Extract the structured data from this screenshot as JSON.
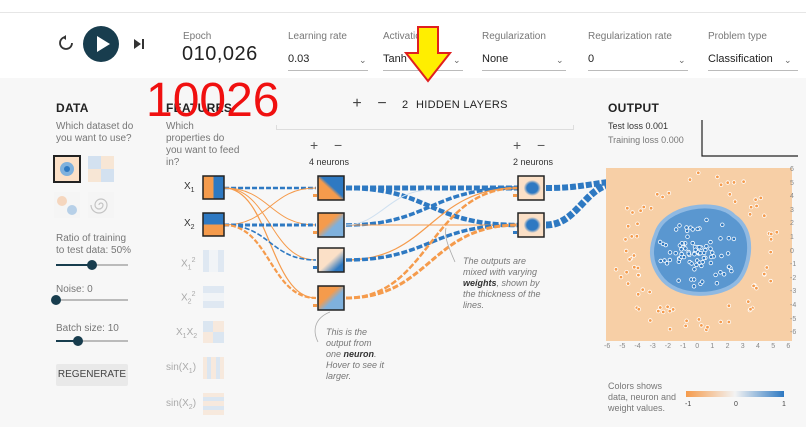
{
  "topbar": {
    "epoch_label": "Epoch",
    "epoch_value": "010,026",
    "learning_rate": {
      "label": "Learning rate",
      "value": "0.03"
    },
    "activation": {
      "label": "Activation",
      "value": "Tanh"
    },
    "regularization": {
      "label": "Regularization",
      "value": "None"
    },
    "regularization_rate": {
      "label": "Regularization rate",
      "value": "0"
    },
    "problem_type": {
      "label": "Problem type",
      "value": "Classification"
    }
  },
  "overlay": {
    "big_number": "10026",
    "arrow_color": "#ffee00",
    "arrow_border": "#e02020"
  },
  "data_panel": {
    "title": "DATA",
    "question": "Which dataset do you want to use?",
    "ratio_label": "Ratio of training to test data:  50%",
    "ratio_value_pct": 50,
    "noise_label": "Noise:  0",
    "noise_value_pct": 0,
    "batch_label": "Batch size:  10",
    "batch_value_pct": 30,
    "regenerate": "REGENERATE"
  },
  "features_panel": {
    "title": "FEATURES",
    "question": "Which properties do you want to feed in?",
    "features": [
      "X",
      "X",
      "X",
      "X",
      "X",
      "sin(X",
      "sin(X"
    ]
  },
  "hidden": {
    "plus": "+",
    "minus": "−",
    "count": "2",
    "label": "HIDDEN LAYERS",
    "layer1_neurons": "4 neurons",
    "layer2_neurons": "2 neurons",
    "annotation_neuron_pre": "This is the output from one",
    "annotation_neuron_bold": "neuron",
    "annotation_neuron_post": ". Hover to see it larger.",
    "annotation_weights_pre": "The outputs are mixed with varying",
    "annotation_weights_bold": "weights",
    "annotation_weights_post": ", shown by the thickness of the lines."
  },
  "output": {
    "title": "OUTPUT",
    "test_loss": "Test loss 0.001",
    "training_loss": "Training loss 0.000",
    "x_ticks": [
      "-6",
      "-5",
      "-4",
      "-3",
      "-2",
      "-1",
      "0",
      "1",
      "2",
      "3",
      "4",
      "5",
      "6"
    ],
    "y_ticks": [
      "6",
      "5",
      "4",
      "3",
      "2",
      "1",
      "0",
      "-1",
      "-2",
      "-3",
      "-4",
      "-5",
      "-6"
    ],
    "legend_text": "Colors shows data, neuron and weight values.",
    "legend_ticks": [
      "-1",
      "0",
      "1"
    ]
  },
  "colors": {
    "orange": "#f59b4c",
    "blue": "#2e79c2",
    "play": "#183d4e"
  }
}
